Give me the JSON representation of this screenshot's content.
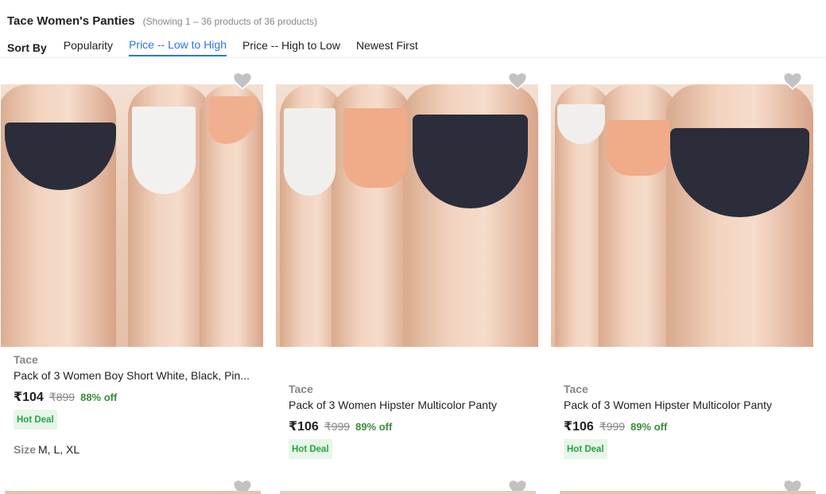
{
  "header": {
    "title": "Tace Women's Panties",
    "result_count": "(Showing 1 – 36 products of 36 products)"
  },
  "sort": {
    "label": "Sort By",
    "options": [
      "Popularity",
      "Price -- Low to High",
      "Price -- High to Low",
      "Newest First"
    ],
    "active_index": 1
  },
  "products": [
    {
      "brand": "Tace",
      "name": "Pack of 3 Women Boy Short White, Black, Pin...",
      "price": "₹104",
      "mrp": "₹899",
      "discount": "88% off",
      "badge": "Hot Deal",
      "size_label": "Size",
      "sizes": "M, L, XL"
    },
    {
      "brand": "Tace",
      "name": "Pack of 3 Women Hipster Multicolor Panty",
      "price": "₹106",
      "mrp": "₹999",
      "discount": "89% off",
      "badge": "Hot Deal"
    },
    {
      "brand": "Tace",
      "name": "Pack of 3 Women Hipster Multicolor Panty",
      "price": "₹106",
      "mrp": "₹999",
      "discount": "89% off",
      "badge": "Hot Deal"
    }
  ],
  "colors": {
    "accent": "#2874f0",
    "discount": "#388e3c",
    "badge_bg": "#e8f5e9",
    "badge_text": "#26a541",
    "muted": "#878787",
    "wishlist_icon": "#c2c2c2"
  },
  "icons": [
    "heart-icon"
  ]
}
